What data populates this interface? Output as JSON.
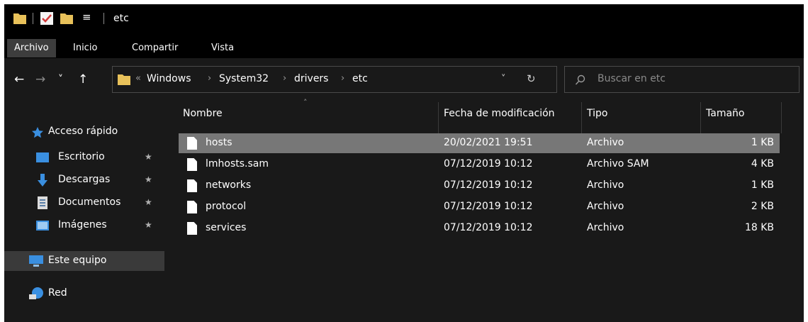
{
  "window": {
    "title": "etc"
  },
  "quick_access_toolbar": {
    "icons": [
      "folder-icon",
      "properties-check-icon",
      "new-folder-icon",
      "customize-dropdown-icon"
    ],
    "dropdown_glyph": "≡"
  },
  "ribbon": {
    "tabs": [
      {
        "label": "Archivo",
        "active": true
      },
      {
        "label": "Inicio",
        "active": false
      },
      {
        "label": "Compartir",
        "active": false
      },
      {
        "label": "Vista",
        "active": false
      }
    ]
  },
  "navigation": {
    "back_icon": "←",
    "forward_icon": "→",
    "recent_icon": "˅",
    "up_icon": "↑"
  },
  "address": {
    "overflow": "«",
    "crumbs": [
      "Windows",
      "System32",
      "drivers",
      "etc"
    ],
    "separator": "›",
    "dropdown_icon": "˅",
    "refresh_icon": "↻"
  },
  "search": {
    "placeholder": "Buscar en etc",
    "icon": "⌕"
  },
  "sidebar": {
    "items": [
      {
        "label": "Acceso rápido",
        "icon": "star-icon",
        "pinned": false,
        "selected": false
      },
      {
        "label": "Escritorio",
        "icon": "desktop-icon",
        "pinned": true,
        "selected": false
      },
      {
        "label": "Descargas",
        "icon": "downloads-icon",
        "pinned": true,
        "selected": false
      },
      {
        "label": "Documentos",
        "icon": "documents-icon",
        "pinned": true,
        "selected": false
      },
      {
        "label": "Imágenes",
        "icon": "pictures-icon",
        "pinned": true,
        "selected": false
      },
      {
        "label": "Este equipo",
        "icon": "this-pc-icon",
        "pinned": false,
        "selected": true
      },
      {
        "label": "Red",
        "icon": "network-icon",
        "pinned": false,
        "selected": false
      }
    ],
    "pin_glyph": "★"
  },
  "file_list": {
    "columns": {
      "name": "Nombre",
      "modified": "Fecha de modificación",
      "type": "Tipo",
      "size": "Tamaño"
    },
    "sort_glyph": "˄",
    "rows": [
      {
        "name": "hosts",
        "modified": "20/02/2021 19:51",
        "type": "Archivo",
        "size": "1 KB",
        "selected": true
      },
      {
        "name": "lmhosts.sam",
        "modified": "07/12/2019 10:12",
        "type": "Archivo SAM",
        "size": "4 KB",
        "selected": false
      },
      {
        "name": "networks",
        "modified": "07/12/2019 10:12",
        "type": "Archivo",
        "size": "1 KB",
        "selected": false
      },
      {
        "name": "protocol",
        "modified": "07/12/2019 10:12",
        "type": "Archivo",
        "size": "2 KB",
        "selected": false
      },
      {
        "name": "services",
        "modified": "07/12/2019 10:12",
        "type": "Archivo",
        "size": "18 KB",
        "selected": false
      }
    ]
  },
  "colors": {
    "background": "#191919",
    "titlebar": "#000000",
    "selection": "#777777",
    "nav_selected": "#3a3a3a",
    "folder": "#e8c15a",
    "accent_blue": "#3a8fe0"
  }
}
